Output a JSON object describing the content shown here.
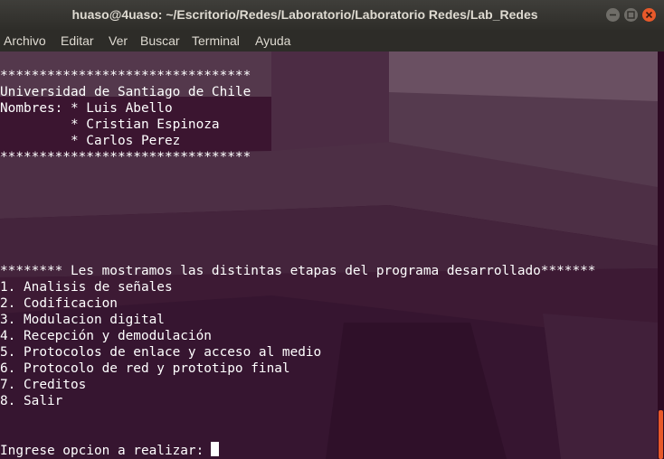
{
  "window": {
    "title": "huaso@4uaso: ~/Escritorio/Redes/Laboratorio/Laboratorio Redes/Lab_Redes"
  },
  "menu": {
    "items": [
      "Archivo",
      "Editar",
      "Ver",
      "Buscar",
      "Terminal",
      "Ayuda"
    ]
  },
  "terminal": {
    "header": {
      "stars_top": "********************************",
      "university": "Universidad de Santiago de Chile",
      "names_1": "Nombres: * Luis Abello",
      "names_2": "         * Cristian Espinoza",
      "names_3": "         * Carlos Perez",
      "stars_bottom": "********************************"
    },
    "menu_title": "******** Les mostramos las distintas etapas del programa desarrollado*******",
    "options": [
      "1. Analisis de señales",
      "2. Codificacion",
      "3. Modulacion digital",
      "4. Recepción y demodulación",
      "5. Protocolos de enlace y acceso al medio",
      "6. Protocolo de red y prototipo final",
      "7. Creditos",
      "8. Salir"
    ],
    "prompt": "Ingrese opcion a realizar:"
  },
  "colors": {
    "terminal_bg": "#3a1430",
    "text": "#ffffff",
    "accent": "#e8592a",
    "titlebar": "#3f3e3a"
  }
}
